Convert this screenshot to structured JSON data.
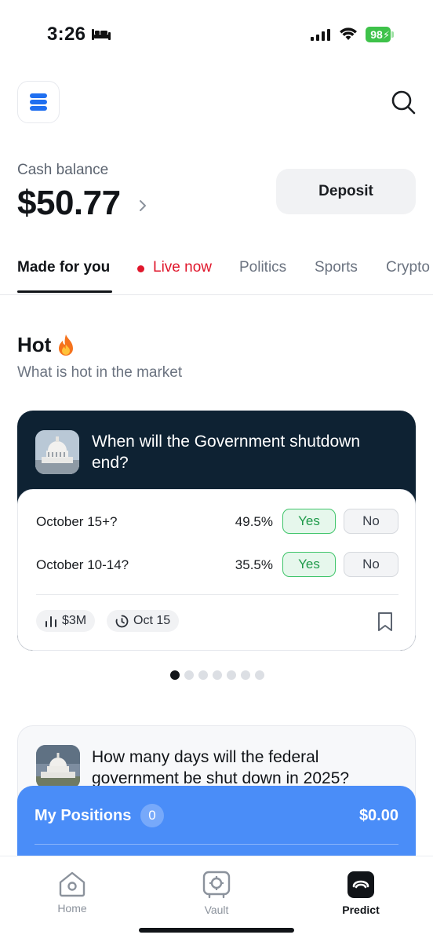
{
  "status_bar": {
    "time": "3:26",
    "battery": "98",
    "icons": [
      "bed-icon",
      "signal-icon",
      "wifi-icon",
      "battery-icon"
    ]
  },
  "header": {
    "logo_icon": "stack-logo-icon",
    "search_icon": "search-icon"
  },
  "balance": {
    "label": "Cash balance",
    "amount": "$50.77",
    "deposit_label": "Deposit"
  },
  "tabs": [
    {
      "label": "Made for you",
      "active": true
    },
    {
      "label": "Live now",
      "live": true
    },
    {
      "label": "Politics"
    },
    {
      "label": "Sports"
    },
    {
      "label": "Crypto"
    }
  ],
  "hot": {
    "title": "Hot",
    "subtitle": "What is hot in the market"
  },
  "market_card": {
    "question": "When will the Government shutdown end?",
    "outcomes": [
      {
        "name": "October 15+?",
        "percent": "49.5%",
        "yes": "Yes",
        "no": "No"
      },
      {
        "name": "October 10-14?",
        "percent": "35.5%",
        "yes": "Yes",
        "no": "No"
      }
    ],
    "volume": "$3M",
    "end_date": "Oct 15"
  },
  "pagination": {
    "count": 7,
    "active_index": 0
  },
  "market_card_2": {
    "question": "How many days will the federal government be shut down in 2025?"
  },
  "positions": {
    "label": "My Positions",
    "count": "0",
    "total": "$0.00"
  },
  "bottom_nav": [
    {
      "label": "Home",
      "icon": "home-icon"
    },
    {
      "label": "Vault",
      "icon": "vault-icon"
    },
    {
      "label": "Predict",
      "icon": "predict-icon",
      "active": true
    }
  ],
  "colors": {
    "accent_blue": "#4a8df8",
    "live_red": "#e0162b",
    "yes_green": "#1f9a4a",
    "card_dark": "#0e2233"
  }
}
